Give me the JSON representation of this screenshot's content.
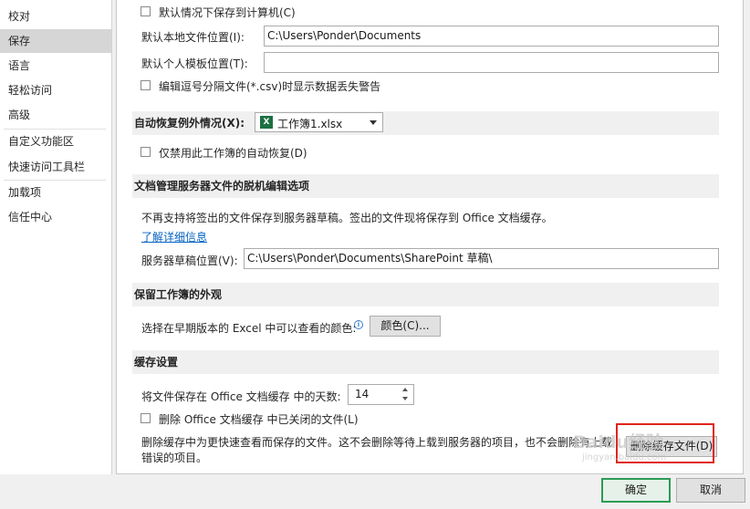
{
  "sidebar": {
    "items": [
      {
        "label": "校对"
      },
      {
        "label": "保存"
      },
      {
        "label": "语言"
      },
      {
        "label": "轻松访问"
      },
      {
        "label": "高级"
      },
      {
        "label": "自定义功能区"
      },
      {
        "label": "快速访问工具栏"
      },
      {
        "label": "加载项"
      },
      {
        "label": "信任中心"
      }
    ]
  },
  "save_workbooks": {
    "save_to_computer_label": "默认情况下保存到计算机(C)",
    "default_local_path_label": "默认本地文件位置(I):",
    "default_local_path_value": "C:\\Users\\Ponder\\Documents",
    "personal_templates_label": "默认个人模板位置(T):",
    "personal_templates_value": "",
    "csv_warning_label": "编辑逗号分隔文件(*.csv)时显示数据丢失警告"
  },
  "autorecover": {
    "header": "自动恢复例外情况(X):",
    "workbook_select": "工作簿1.xlsx",
    "excel_icon_letter": "X",
    "disable_autorecover_label": "仅禁用此工作簿的自动恢复(D)"
  },
  "offline_editing": {
    "header": "文档管理服务器文件的脱机编辑选项",
    "description": "不再支持将签出的文件保存到服务器草稿。签出的文件现将保存到 Office 文档缓存。",
    "learn_more": "了解详细信息",
    "server_drafts_label": "服务器草稿位置(V):",
    "server_drafts_value": "C:\\Users\\Ponder\\Documents\\SharePoint 草稿\\"
  },
  "preserve_visual": {
    "header": "保留工作簿的外观",
    "colors_label": "选择在早期版本的 Excel 中可以查看的颜色:",
    "colors_button": "颜色(C)..."
  },
  "cache_settings": {
    "header": "缓存设置",
    "days_label": "将文件保存在 Office 文档缓存 中的天数:",
    "days_value": "14",
    "delete_closed_label": "删除 Office 文档缓存 中已关闭的文件(L)",
    "description_line1": "删除缓存中为更快速查看而保存的文件。这不会删除等待上载到服务器的项目，也不会删除有上载",
    "description_line2": "错误的项目。",
    "delete_cached_button": "删除缓存文件(D)"
  },
  "footer": {
    "ok_label": "确定",
    "cancel_label": "取消"
  },
  "watermark": {
    "text1": "Baidu",
    "text2": "经验",
    "text3": "jingyan.baidu.com"
  },
  "colors": {
    "highlight": "#e0241b",
    "ok_border": "#2c9b55",
    "link": "#0563c1",
    "excel_green": "#1d6f42"
  }
}
